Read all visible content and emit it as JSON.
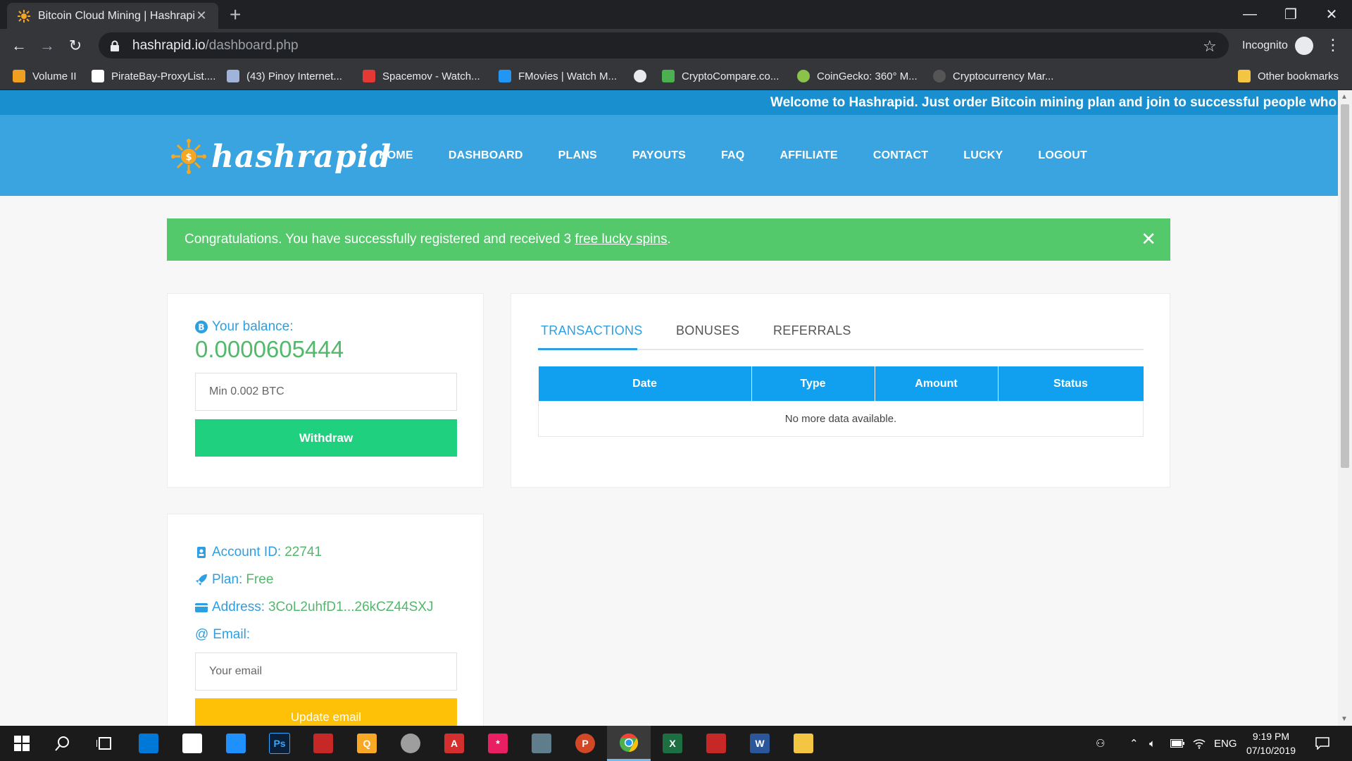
{
  "browser": {
    "tab_title": "Bitcoin Cloud Mining | Hashrapid",
    "url_host": "hashrapid.io",
    "url_path": "/dashboard.php",
    "incognito_label": "Incognito",
    "bookmarks": [
      {
        "label": "Volume II",
        "color": "#f0a020"
      },
      {
        "label": "PirateBay-ProxyList....",
        "color": "#ffffff"
      },
      {
        "label": "(43) Pinoy Internet...",
        "color": "#9fb4d8"
      },
      {
        "label": "Spacemov - Watch...",
        "color": "#e53935"
      },
      {
        "label": "FMovies | Watch M...",
        "color": "#2196f3"
      },
      {
        "label": "",
        "color": "#e8eaed"
      },
      {
        "label": "CryptoCompare.co...",
        "color": "#4caf50"
      },
      {
        "label": "CoinGecko: 360° M...",
        "color": "#8bc34a"
      },
      {
        "label": "Cryptocurrency Mar...",
        "color": "#555555"
      }
    ],
    "other_bookmarks": "Other bookmarks"
  },
  "site": {
    "ticker": "Welcome to Hashrapid. Just order Bitcoin mining plan and join to successful people who earned big",
    "logo_text": "hashrapid",
    "nav": [
      "HOME",
      "DASHBOARD",
      "PLANS",
      "PAYOUTS",
      "FAQ",
      "AFFILIATE",
      "CONTACT",
      "LUCKY",
      "LOGOUT"
    ],
    "alert": {
      "text_before": "Congratulations. You have successfully registered and received 3 ",
      "link": "free lucky spins",
      "text_after": "."
    },
    "balance": {
      "label": "Your balance:",
      "value": "0.0000605444",
      "withdraw_placeholder": "Min 0.002 BTC",
      "withdraw_button": "Withdraw"
    },
    "account": {
      "id_label": "Account ID:",
      "id_value": "22741",
      "plan_label": "Plan:",
      "plan_value": "Free",
      "address_label": "Address:",
      "address_value": "3CoL2uhfD1...26kCZ44SXJ",
      "email_label": "Email:",
      "email_placeholder": "Your email",
      "update_button": "Update email"
    },
    "tabs": [
      "TRANSACTIONS",
      "BONUSES",
      "REFERRALS"
    ],
    "table": {
      "headers": [
        "Date",
        "Type",
        "Amount",
        "Status"
      ],
      "empty": "No more data available."
    }
  },
  "taskbar": {
    "apps": [
      {
        "icon": "store-icon",
        "color": "#0078d7",
        "glyph": ""
      },
      {
        "icon": "mail-icon",
        "color": "#ffffff",
        "glyph": ""
      },
      {
        "icon": "app-icon",
        "color": "#1e90ff",
        "glyph": ""
      },
      {
        "icon": "photoshop-icon",
        "color": "#0a1f3a",
        "glyph": "Ps"
      },
      {
        "icon": "app-red-icon",
        "color": "#c62828",
        "glyph": ""
      },
      {
        "icon": "app-yellow-icon",
        "color": "#f9a825",
        "glyph": "Q"
      },
      {
        "icon": "globe-icon",
        "color": "#9e9e9e",
        "glyph": ""
      },
      {
        "icon": "acrobat-icon",
        "color": "#d32f2f",
        "glyph": "A"
      },
      {
        "icon": "app-pink-icon",
        "color": "#e91e63",
        "glyph": "*"
      },
      {
        "icon": "app-grey-icon",
        "color": "#607d8b",
        "glyph": ""
      },
      {
        "icon": "powerpoint-icon",
        "color": "#d24726",
        "glyph": "P"
      },
      {
        "icon": "chrome-icon",
        "color": "#4caf50",
        "glyph": ""
      },
      {
        "icon": "excel-icon",
        "color": "#1d6f42",
        "glyph": "X"
      },
      {
        "icon": "pdf-icon",
        "color": "#c62828",
        "glyph": ""
      },
      {
        "icon": "word-icon",
        "color": "#2b579a",
        "glyph": "W"
      },
      {
        "icon": "folder-icon",
        "color": "#f4c542",
        "glyph": ""
      }
    ],
    "lang": "ENG",
    "time": "9:19 PM",
    "date": "07/10/2019"
  }
}
